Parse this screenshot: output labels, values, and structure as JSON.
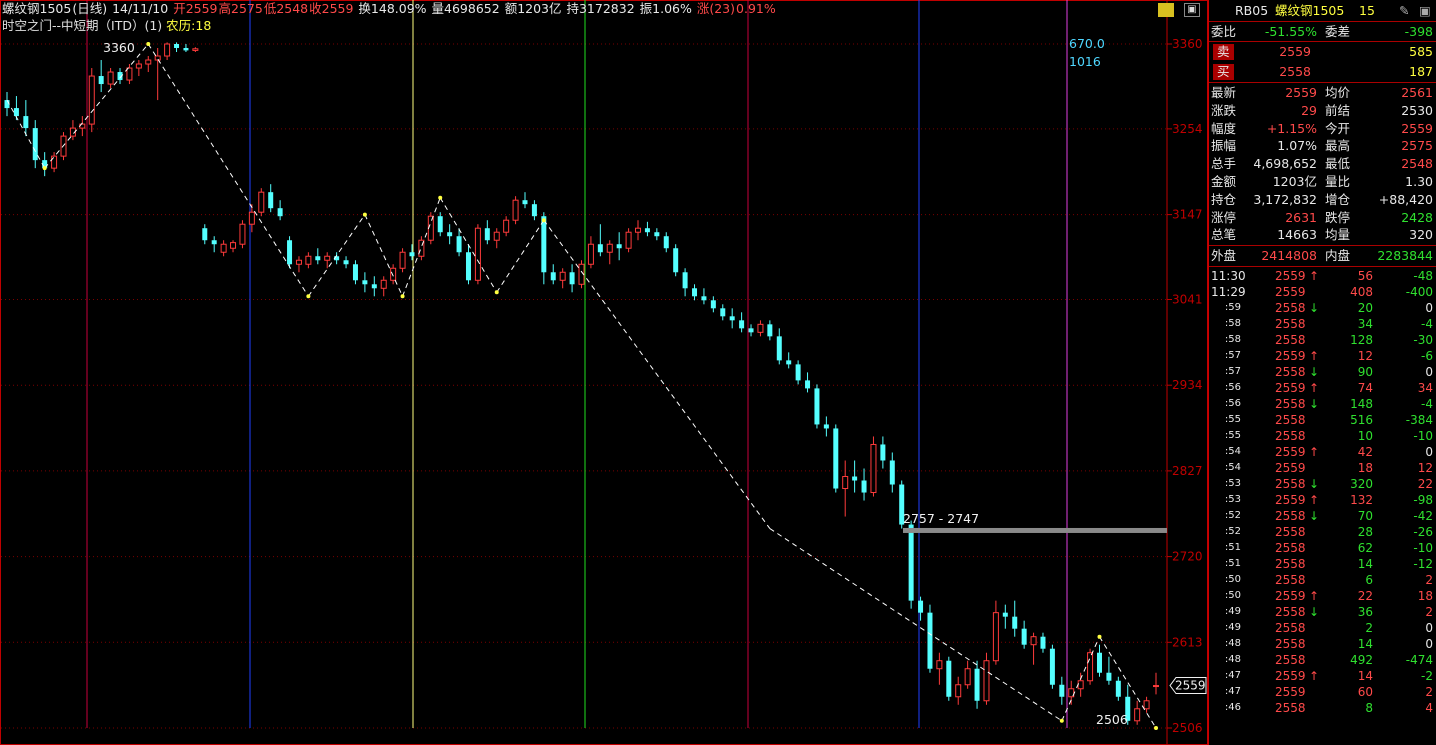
{
  "header": {
    "symbol": "螺纹钢1505",
    "period": "(日线)",
    "date": "14/11/10",
    "open": "开2559",
    "high": "高2575",
    "low": "低2548",
    "close": "收2559",
    "turnover": "换148.09%",
    "volume": "量4698652",
    "amount": "额1203亿",
    "position": "持3172832",
    "amplitude": "振1.06%",
    "change_label": "涨(23)",
    "change_pct": "0.91%"
  },
  "subheader": {
    "indicator": "时空之门--中短期（ITD）(1)",
    "lunar": "农历:18"
  },
  "toolbar": {
    "icons": [
      "toggle-icon",
      "restore-icon"
    ]
  },
  "chart": {
    "y_ticks": [
      "3360",
      "3254",
      "3147",
      "3041",
      "2934",
      "2827",
      "2720",
      "2613",
      "2506"
    ],
    "last_price_tag": "2559",
    "annotations": {
      "high_label": "3360",
      "low_label": "2506",
      "zone_label": "2757 - 2747",
      "cycle_value": "670.0",
      "cycle_count": "1016"
    },
    "colors": {
      "up": "#ff3b3b",
      "down": "#54ffff",
      "grid_red": "#c80000"
    }
  },
  "chart_data": {
    "type": "candlestick",
    "ylim": [
      2506,
      3360
    ],
    "y_ticks": [
      3360,
      3254,
      3147,
      3041,
      2934,
      2827,
      2720,
      2613,
      2506
    ],
    "candles": [
      [
        3290,
        3300,
        3270,
        3280
      ],
      [
        3280,
        3295,
        3265,
        3270
      ],
      [
        3270,
        3290,
        3245,
        3255
      ],
      [
        3255,
        3265,
        3205,
        3215
      ],
      [
        3215,
        3225,
        3195,
        3205
      ],
      [
        3205,
        3225,
        3200,
        3220
      ],
      [
        3220,
        3250,
        3215,
        3245
      ],
      [
        3245,
        3265,
        3240,
        3255
      ],
      [
        3255,
        3270,
        3245,
        3260
      ],
      [
        3260,
        3330,
        3250,
        3320
      ],
      [
        3320,
        3340,
        3300,
        3310
      ],
      [
        3310,
        3330,
        3305,
        3325
      ],
      [
        3325,
        3330,
        3310,
        3315
      ],
      [
        3315,
        3335,
        3310,
        3330
      ],
      [
        3330,
        3340,
        3320,
        3335
      ],
      [
        3335,
        3345,
        3325,
        3340
      ],
      [
        3340,
        3355,
        3290,
        3345
      ],
      [
        3345,
        3362,
        3340,
        3360
      ],
      [
        3360,
        3362,
        3350,
        3355
      ],
      [
        3355,
        3360,
        3350,
        3352
      ],
      [
        3352,
        3356,
        3350,
        3354
      ],
      [
        3130,
        3135,
        3110,
        3115
      ],
      [
        3115,
        3120,
        3100,
        3110
      ],
      [
        3100,
        3115,
        3095,
        3110
      ],
      [
        3105,
        3115,
        3100,
        3112
      ],
      [
        3110,
        3140,
        3105,
        3135
      ],
      [
        3135,
        3160,
        3125,
        3150
      ],
      [
        3150,
        3180,
        3145,
        3175
      ],
      [
        3175,
        3185,
        3150,
        3155
      ],
      [
        3155,
        3165,
        3140,
        3145
      ],
      [
        3115,
        3120,
        3080,
        3085
      ],
      [
        3085,
        3095,
        3075,
        3090
      ],
      [
        3085,
        3100,
        3080,
        3095
      ],
      [
        3095,
        3105,
        3085,
        3090
      ],
      [
        3090,
        3100,
        3080,
        3095
      ],
      [
        3095,
        3100,
        3085,
        3090
      ],
      [
        3090,
        3095,
        3080,
        3085
      ],
      [
        3085,
        3090,
        3060,
        3065
      ],
      [
        3065,
        3075,
        3050,
        3060
      ],
      [
        3060,
        3070,
        3045,
        3055
      ],
      [
        3055,
        3070,
        3045,
        3065
      ],
      [
        3065,
        3085,
        3060,
        3080
      ],
      [
        3080,
        3105,
        3075,
        3100
      ],
      [
        3100,
        3110,
        3090,
        3095
      ],
      [
        3095,
        3120,
        3090,
        3115
      ],
      [
        3115,
        3150,
        3110,
        3145
      ],
      [
        3145,
        3150,
        3120,
        3125
      ],
      [
        3125,
        3135,
        3110,
        3120
      ],
      [
        3120,
        3130,
        3095,
        3100
      ],
      [
        3100,
        3110,
        3060,
        3065
      ],
      [
        3065,
        3135,
        3060,
        3130
      ],
      [
        3130,
        3140,
        3110,
        3115
      ],
      [
        3115,
        3130,
        3105,
        3125
      ],
      [
        3125,
        3145,
        3120,
        3140
      ],
      [
        3140,
        3170,
        3135,
        3165
      ],
      [
        3165,
        3175,
        3155,
        3160
      ],
      [
        3160,
        3165,
        3140,
        3145
      ],
      [
        3145,
        3150,
        3060,
        3075
      ],
      [
        3075,
        3085,
        3060,
        3065
      ],
      [
        3065,
        3080,
        3055,
        3075
      ],
      [
        3075,
        3085,
        3050,
        3060
      ],
      [
        3060,
        3090,
        3055,
        3085
      ],
      [
        3085,
        3120,
        3080,
        3110
      ],
      [
        3110,
        3135,
        3095,
        3100
      ],
      [
        3100,
        3115,
        3085,
        3110
      ],
      [
        3110,
        3125,
        3090,
        3105
      ],
      [
        3105,
        3130,
        3100,
        3125
      ],
      [
        3125,
        3140,
        3115,
        3130
      ],
      [
        3130,
        3138,
        3120,
        3125
      ],
      [
        3125,
        3130,
        3115,
        3120
      ],
      [
        3120,
        3125,
        3100,
        3105
      ],
      [
        3105,
        3110,
        3070,
        3075
      ],
      [
        3075,
        3080,
        3045,
        3055
      ],
      [
        3055,
        3060,
        3040,
        3045
      ],
      [
        3045,
        3055,
        3035,
        3040
      ],
      [
        3040,
        3045,
        3025,
        3030
      ],
      [
        3030,
        3035,
        3015,
        3020
      ],
      [
        3020,
        3030,
        3005,
        3015
      ],
      [
        3015,
        3025,
        3000,
        3005
      ],
      [
        3005,
        3010,
        2995,
        3000
      ],
      [
        3000,
        3015,
        2995,
        3010
      ],
      [
        3010,
        3015,
        2990,
        2995
      ],
      [
        2995,
        3005,
        2960,
        2965
      ],
      [
        2965,
        2975,
        2955,
        2960
      ],
      [
        2960,
        2965,
        2935,
        2940
      ],
      [
        2940,
        2950,
        2925,
        2930
      ],
      [
        2930,
        2935,
        2880,
        2885
      ],
      [
        2885,
        2895,
        2870,
        2880
      ],
      [
        2880,
        2885,
        2800,
        2805
      ],
      [
        2805,
        2840,
        2770,
        2820
      ],
      [
        2820,
        2840,
        2800,
        2815
      ],
      [
        2815,
        2830,
        2790,
        2800
      ],
      [
        2800,
        2870,
        2795,
        2860
      ],
      [
        2860,
        2870,
        2830,
        2840
      ],
      [
        2840,
        2850,
        2800,
        2810
      ],
      [
        2810,
        2815,
        2755,
        2760
      ],
      [
        2760,
        2765,
        2655,
        2665
      ],
      [
        2665,
        2670,
        2640,
        2650
      ],
      [
        2650,
        2660,
        2575,
        2580
      ],
      [
        2580,
        2600,
        2560,
        2590
      ],
      [
        2590,
        2595,
        2540,
        2545
      ],
      [
        2545,
        2570,
        2535,
        2560
      ],
      [
        2560,
        2590,
        2555,
        2580
      ],
      [
        2580,
        2590,
        2530,
        2540
      ],
      [
        2540,
        2600,
        2535,
        2590
      ],
      [
        2590,
        2665,
        2585,
        2650
      ],
      [
        2650,
        2660,
        2630,
        2645
      ],
      [
        2645,
        2665,
        2620,
        2630
      ],
      [
        2630,
        2640,
        2605,
        2610
      ],
      [
        2610,
        2625,
        2585,
        2620
      ],
      [
        2620,
        2625,
        2600,
        2605
      ],
      [
        2605,
        2610,
        2555,
        2560
      ],
      [
        2560,
        2570,
        2535,
        2545
      ],
      [
        2545,
        2565,
        2535,
        2555
      ],
      [
        2555,
        2575,
        2545,
        2565
      ],
      [
        2565,
        2605,
        2560,
        2600
      ],
      [
        2600,
        2610,
        2570,
        2575
      ],
      [
        2575,
        2595,
        2560,
        2565
      ],
      [
        2565,
        2570,
        2540,
        2545
      ],
      [
        2545,
        2560,
        2510,
        2515
      ],
      [
        2515,
        2540,
        2510,
        2530
      ],
      [
        2530,
        2545,
        2525,
        2540
      ],
      [
        2559,
        2575,
        2548,
        2559
      ]
    ]
  },
  "panel": {
    "title_code": "RB05",
    "title_name": "螺纹钢1505",
    "title_num": "15",
    "weibi_label": "委比",
    "weibi_val": "-51.55%",
    "weicha_label": "委差",
    "weicha_val": "-398",
    "sell_label": "卖",
    "sell_price": "2559",
    "sell_vol": "585",
    "buy_label": "买",
    "buy_price": "2558",
    "buy_vol": "187",
    "stats": [
      {
        "l1": "最新",
        "v1": "2559",
        "c1": "red",
        "l2": "均价",
        "v2": "2561",
        "c2": "red"
      },
      {
        "l1": "涨跌",
        "v1": "29",
        "c1": "red",
        "l2": "前结",
        "v2": "2530",
        "c2": "white"
      },
      {
        "l1": "幅度",
        "v1": "+1.15%",
        "c1": "red",
        "l2": "今开",
        "v2": "2559",
        "c2": "red"
      },
      {
        "l1": "振幅",
        "v1": "1.07%",
        "c1": "white",
        "l2": "最高",
        "v2": "2575",
        "c2": "red"
      },
      {
        "l1": "总手",
        "v1": "4,698,652",
        "c1": "white",
        "l2": "最低",
        "v2": "2548",
        "c2": "red"
      },
      {
        "l1": "金额",
        "v1": "1203亿",
        "c1": "white",
        "l2": "量比",
        "v2": "1.30",
        "c2": "white"
      },
      {
        "l1": "持仓",
        "v1": "3,172,832",
        "c1": "white",
        "l2": "增仓",
        "v2": "+88,420",
        "c2": "white"
      },
      {
        "l1": "涨停",
        "v1": "2631",
        "c1": "red",
        "l2": "跌停",
        "v2": "2428",
        "c2": "green"
      },
      {
        "l1": "总笔",
        "v1": "14663",
        "c1": "white",
        "l2": "均量",
        "v2": "320",
        "c2": "white"
      }
    ],
    "outer_label": "外盘",
    "outer_val": "2414808",
    "inner_label": "内盘",
    "inner_val": "2283844",
    "ticks": [
      {
        "t": "11:30",
        "p": "2559",
        "pc": "red",
        "a": "↑",
        "ac": "red",
        "v": "56",
        "vc": "red",
        "d": "-48",
        "dc": "green"
      },
      {
        "t": "11:29",
        "p": "2559",
        "pc": "red",
        "a": "",
        "ac": "red",
        "v": "408",
        "vc": "red",
        "d": "-400",
        "dc": "green"
      },
      {
        "t": ":59",
        "p": "2558",
        "pc": "red",
        "a": "↓",
        "ac": "green",
        "v": "20",
        "vc": "green",
        "d": "0",
        "dc": "white"
      },
      {
        "t": ":58",
        "p": "2558",
        "pc": "red",
        "a": "",
        "ac": "red",
        "v": "34",
        "vc": "green",
        "d": "-4",
        "dc": "green"
      },
      {
        "t": ":58",
        "p": "2558",
        "pc": "red",
        "a": "",
        "ac": "red",
        "v": "128",
        "vc": "green",
        "d": "-30",
        "dc": "green"
      },
      {
        "t": ":57",
        "p": "2559",
        "pc": "red",
        "a": "↑",
        "ac": "red",
        "v": "12",
        "vc": "red",
        "d": "-6",
        "dc": "green"
      },
      {
        "t": ":57",
        "p": "2558",
        "pc": "red",
        "a": "↓",
        "ac": "green",
        "v": "90",
        "vc": "green",
        "d": "0",
        "dc": "white"
      },
      {
        "t": ":56",
        "p": "2559",
        "pc": "red",
        "a": "↑",
        "ac": "red",
        "v": "74",
        "vc": "red",
        "d": "34",
        "dc": "red"
      },
      {
        "t": ":56",
        "p": "2558",
        "pc": "red",
        "a": "↓",
        "ac": "green",
        "v": "148",
        "vc": "green",
        "d": "-4",
        "dc": "green"
      },
      {
        "t": ":55",
        "p": "2558",
        "pc": "red",
        "a": "",
        "ac": "red",
        "v": "516",
        "vc": "green",
        "d": "-384",
        "dc": "green"
      },
      {
        "t": ":55",
        "p": "2558",
        "pc": "red",
        "a": "",
        "ac": "red",
        "v": "10",
        "vc": "green",
        "d": "-10",
        "dc": "green"
      },
      {
        "t": ":54",
        "p": "2559",
        "pc": "red",
        "a": "↑",
        "ac": "red",
        "v": "42",
        "vc": "red",
        "d": "0",
        "dc": "white"
      },
      {
        "t": ":54",
        "p": "2559",
        "pc": "red",
        "a": "",
        "ac": "red",
        "v": "18",
        "vc": "red",
        "d": "12",
        "dc": "red"
      },
      {
        "t": ":53",
        "p": "2558",
        "pc": "red",
        "a": "↓",
        "ac": "green",
        "v": "320",
        "vc": "green",
        "d": "22",
        "dc": "red"
      },
      {
        "t": ":53",
        "p": "2559",
        "pc": "red",
        "a": "↑",
        "ac": "red",
        "v": "132",
        "vc": "red",
        "d": "-98",
        "dc": "green"
      },
      {
        "t": ":52",
        "p": "2558",
        "pc": "red",
        "a": "↓",
        "ac": "green",
        "v": "70",
        "vc": "green",
        "d": "-42",
        "dc": "green"
      },
      {
        "t": ":52",
        "p": "2558",
        "pc": "red",
        "a": "",
        "ac": "red",
        "v": "28",
        "vc": "green",
        "d": "-26",
        "dc": "green"
      },
      {
        "t": ":51",
        "p": "2558",
        "pc": "red",
        "a": "",
        "ac": "red",
        "v": "62",
        "vc": "green",
        "d": "-10",
        "dc": "green"
      },
      {
        "t": ":51",
        "p": "2558",
        "pc": "red",
        "a": "",
        "ac": "red",
        "v": "14",
        "vc": "green",
        "d": "-12",
        "dc": "green"
      },
      {
        "t": ":50",
        "p": "2558",
        "pc": "red",
        "a": "",
        "ac": "red",
        "v": "6",
        "vc": "green",
        "d": "2",
        "dc": "red"
      },
      {
        "t": ":50",
        "p": "2559",
        "pc": "red",
        "a": "↑",
        "ac": "red",
        "v": "22",
        "vc": "red",
        "d": "18",
        "dc": "red"
      },
      {
        "t": ":49",
        "p": "2558",
        "pc": "red",
        "a": "↓",
        "ac": "green",
        "v": "36",
        "vc": "green",
        "d": "2",
        "dc": "red"
      },
      {
        "t": ":49",
        "p": "2558",
        "pc": "red",
        "a": "",
        "ac": "red",
        "v": "2",
        "vc": "green",
        "d": "0",
        "dc": "white"
      },
      {
        "t": ":48",
        "p": "2558",
        "pc": "red",
        "a": "",
        "ac": "red",
        "v": "14",
        "vc": "green",
        "d": "0",
        "dc": "white"
      },
      {
        "t": ":48",
        "p": "2558",
        "pc": "red",
        "a": "",
        "ac": "red",
        "v": "492",
        "vc": "green",
        "d": "-474",
        "dc": "green"
      },
      {
        "t": ":47",
        "p": "2559",
        "pc": "red",
        "a": "↑",
        "ac": "red",
        "v": "14",
        "vc": "red",
        "d": "-2",
        "dc": "green"
      },
      {
        "t": ":47",
        "p": "2559",
        "pc": "red",
        "a": "",
        "ac": "red",
        "v": "60",
        "vc": "red",
        "d": "2",
        "dc": "red"
      },
      {
        "t": ":46",
        "p": "2558",
        "pc": "red",
        "a": "",
        "ac": "red",
        "v": "8",
        "vc": "green",
        "d": "4",
        "dc": "red"
      }
    ]
  }
}
